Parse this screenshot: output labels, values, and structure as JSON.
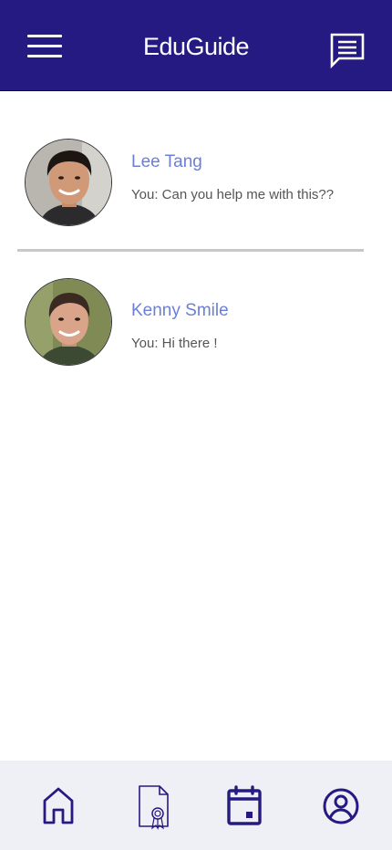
{
  "header": {
    "title": "EduGuide",
    "background_color": "#241a82",
    "menu_icon": "hamburger-menu-icon",
    "chat_icon": "message-square-icon"
  },
  "conversations": [
    {
      "name": "Lee Tang",
      "last_message": "You: Can you help me with this??",
      "avatar": "profile-photo"
    },
    {
      "name": "Kenny Smile",
      "last_message": "You: Hi there !",
      "avatar": "profile-photo"
    }
  ],
  "bottom_nav": {
    "items": [
      {
        "icon": "home-icon"
      },
      {
        "icon": "certificate-document-icon"
      },
      {
        "icon": "calendar-icon"
      },
      {
        "icon": "user-profile-icon"
      }
    ],
    "accent_color": "#241a82",
    "background_color": "#eef0f6"
  },
  "colors": {
    "name_text": "#6b7fd8",
    "message_text": "#555555",
    "divider": "#c8c8c8"
  }
}
